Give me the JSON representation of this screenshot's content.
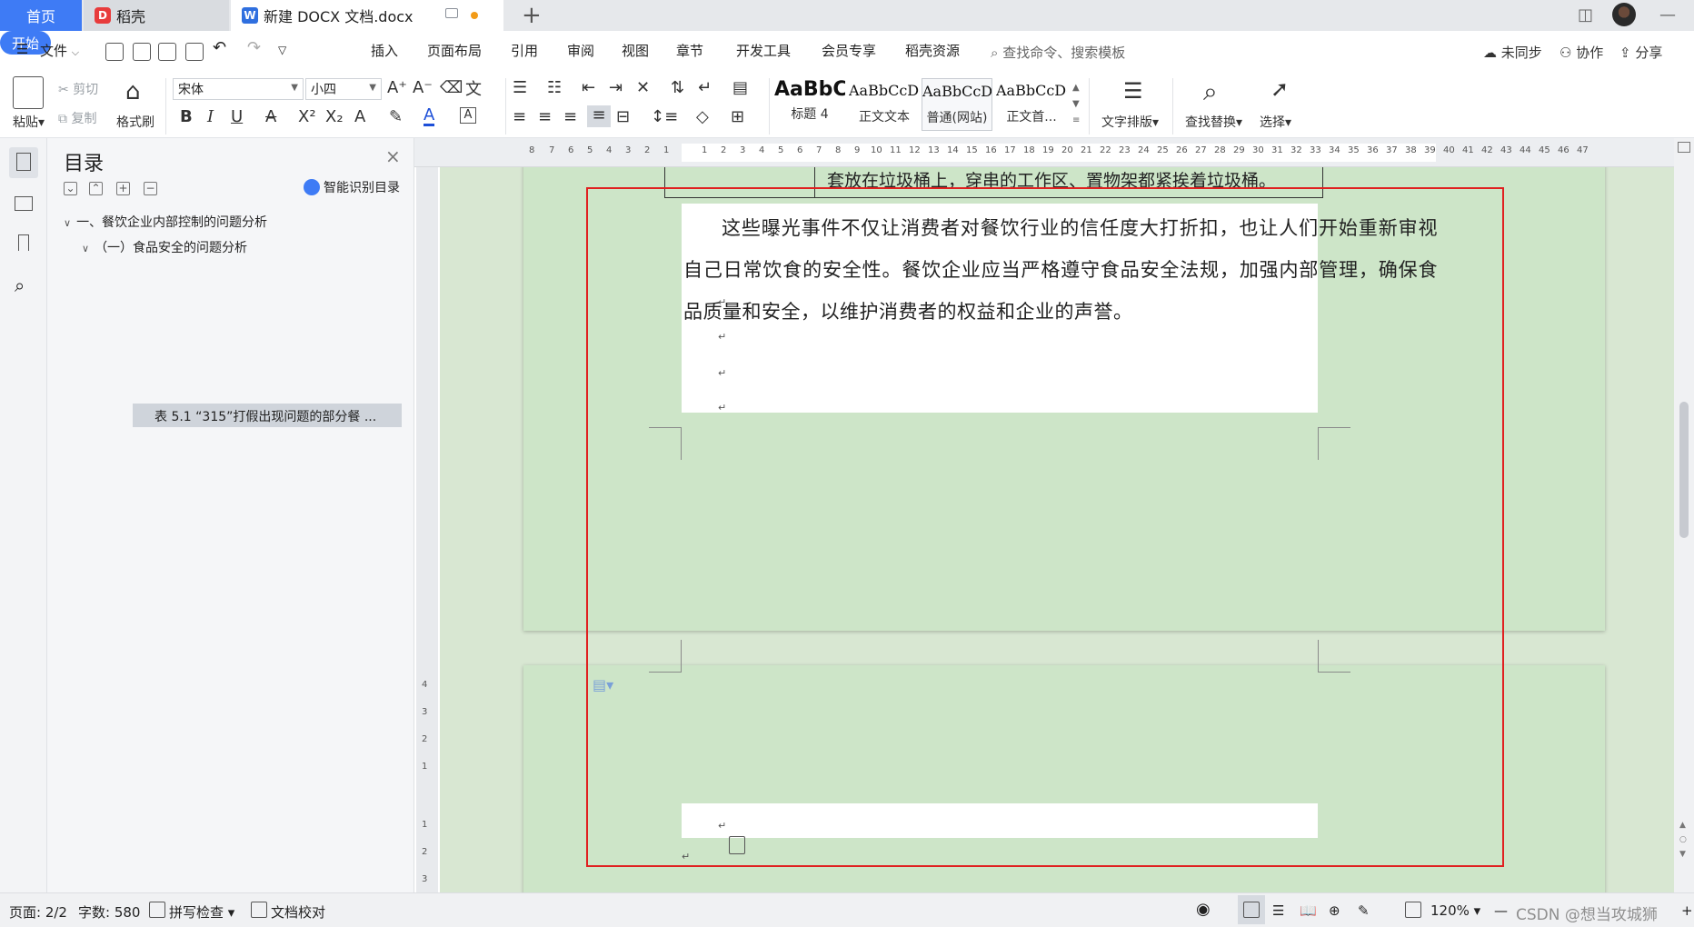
{
  "tabs": [
    {
      "label": "首页"
    },
    {
      "label": "稻壳"
    },
    {
      "label": "新建 DOCX 文档.docx"
    }
  ],
  "menu": {
    "file": "文件",
    "start": "开始",
    "items": [
      "插入",
      "页面布局",
      "引用",
      "审阅",
      "视图",
      "章节",
      "开发工具",
      "会员专享",
      "稻壳资源"
    ],
    "search_placeholder": "查找命令、搜索模板",
    "right": [
      "未同步",
      "协作",
      "分享"
    ]
  },
  "ribbon": {
    "paste": "粘贴",
    "cut": "剪切",
    "copy": "复制",
    "format_painter": "格式刷",
    "font_name": "宋体",
    "font_size": "小四",
    "styles": [
      {
        "preview": "AaBbC",
        "name": "标题 4"
      },
      {
        "preview": "AaBbCcDd",
        "name": "正文文本"
      },
      {
        "preview": "AaBbCcDd",
        "name": "普通(网站)"
      },
      {
        "preview": "AaBbCcDd",
        "name": "正文首..."
      }
    ],
    "text_layout": "文字排版",
    "find_replace": "查找替换",
    "select": "选择"
  },
  "toc": {
    "title": "目录",
    "smart": "智能识别目录",
    "items": [
      "一、餐饮企业内部控制的问题分析",
      "（一）食品安全的问题分析",
      "表 5.1 “315”打假出现问题的部分餐 ..."
    ]
  },
  "ruler": {
    "h_left": [
      "8",
      "7",
      "6",
      "5",
      "4",
      "3",
      "2",
      "1"
    ],
    "h_right": [
      "1",
      "2",
      "3",
      "4",
      "5",
      "6",
      "7",
      "8",
      "9",
      "10",
      "11",
      "12",
      "13",
      "14",
      "15",
      "16",
      "17",
      "18",
      "19",
      "20",
      "21",
      "22",
      "23",
      "24",
      "25",
      "26",
      "27",
      "28",
      "29",
      "30",
      "31",
      "32",
      "33",
      "34",
      "35",
      "36",
      "37",
      "38",
      "39",
      "40",
      "41",
      "42",
      "43",
      "44",
      "45",
      "46",
      "47"
    ],
    "v": [
      "4",
      "3",
      "2",
      "1",
      "1",
      "2",
      "3"
    ]
  },
  "document": {
    "table_text": "套放在垃圾桶上，穿串的工作区、置物架都紧挨着垃圾桶。",
    "paragraph": "这些曝光事件不仅让消费者对餐饮行业的信任度大打折扣，也让人们开始重新审视自己日常饮食的安全性。餐饮企业应当严格遵守食品安全法规，加强内部管理，确保食品质量和安全，以维护消费者的权益和企业的声誉。",
    "para_mark": "↵"
  },
  "status": {
    "page": "页面: 2/2",
    "words": "字数: 580",
    "spell": "拼写检查",
    "proof": "文档校对",
    "zoom": "120%",
    "watermark": "CSDN @想当攻城狮"
  },
  "colors": {
    "accent": "#3e7bf5",
    "page_bg": "#cde5c8",
    "highlight_box": "#e02020"
  }
}
